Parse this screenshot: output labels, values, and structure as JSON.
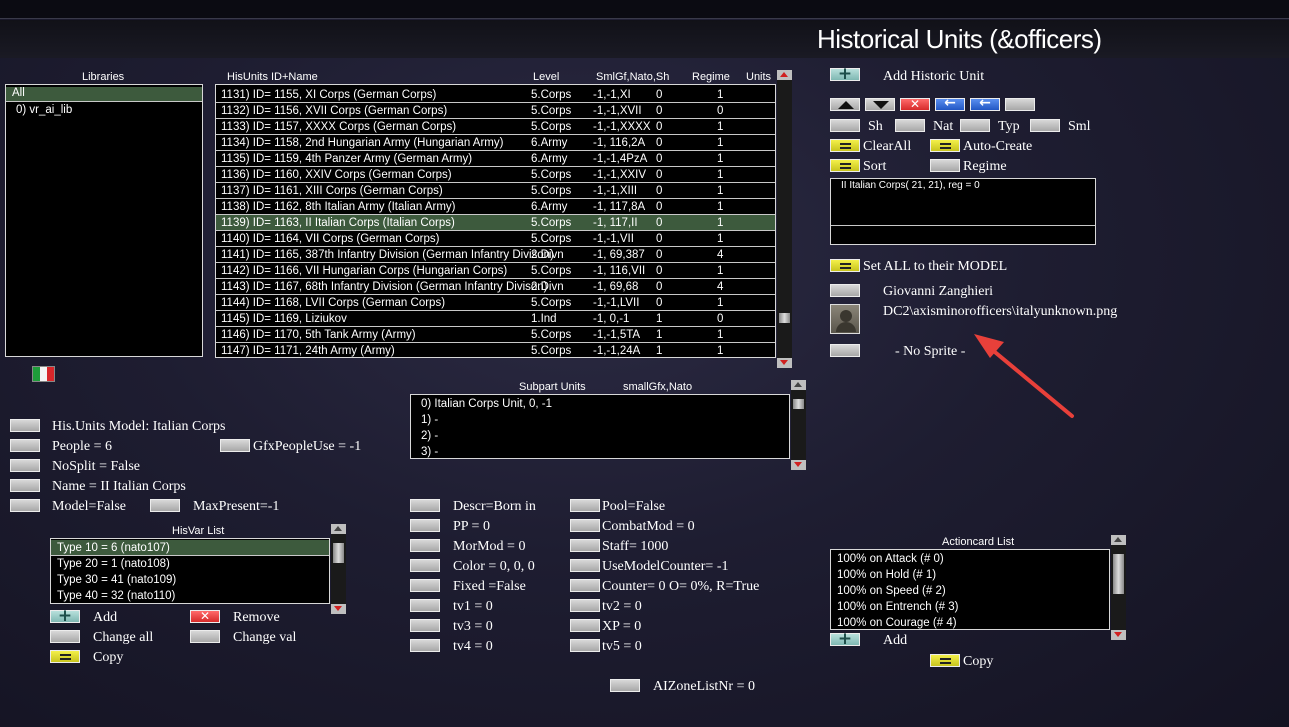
{
  "title": "Historical Units (&officers)",
  "libraries": {
    "header": "Libraries",
    "items": [
      "All",
      "0) vr_ai_lib"
    ]
  },
  "hisunits": {
    "headers": {
      "name": "HisUnits ID+Name",
      "level": "Level",
      "smlgf": "SmlGf,Nato,Sh",
      "regime": "Regime",
      "units": "Units"
    },
    "rows": [
      {
        "name": "1131) ID= 1155, XI Corps (German Corps)",
        "level": "5.Corps",
        "gfx": "-1,-1,XI",
        "sh": "0",
        "reg": "1"
      },
      {
        "name": "1132) ID= 1156, XVII Corps (German Corps)",
        "level": "5.Corps",
        "gfx": "-1,-1,XVII",
        "sh": "0",
        "reg": "0"
      },
      {
        "name": "1133) ID= 1157, XXXX Corps (German Corps)",
        "level": "5.Corps",
        "gfx": "-1,-1,XXXX",
        "sh": "0",
        "reg": "1"
      },
      {
        "name": "1134) ID= 1158, 2nd Hungarian Army (Hungarian Army)",
        "level": "6.Army",
        "gfx": "-1, 116,2A",
        "sh": "0",
        "reg": "1"
      },
      {
        "name": "1135) ID= 1159, 4th Panzer Army (German Army)",
        "level": "6.Army",
        "gfx": "-1,-1,4PzA",
        "sh": "0",
        "reg": "1"
      },
      {
        "name": "1136) ID= 1160, XXIV Corps (German Corps)",
        "level": "5.Corps",
        "gfx": "-1,-1,XXIV",
        "sh": "0",
        "reg": "1"
      },
      {
        "name": "1137) ID= 1161, XIII Corps (German Corps)",
        "level": "5.Corps",
        "gfx": "-1,-1,XIII",
        "sh": "0",
        "reg": "1"
      },
      {
        "name": "1138) ID= 1162, 8th Italian Army (Italian Army)",
        "level": "6.Army",
        "gfx": "-1, 117,8A",
        "sh": "0",
        "reg": "1"
      },
      {
        "name": "1139) ID= 1163, II Italian Corps (Italian Corps)",
        "level": "5.Corps",
        "gfx": "-1, 117,II",
        "sh": "0",
        "reg": "1"
      },
      {
        "name": "1140) ID= 1164, VII Corps (German Corps)",
        "level": "5.Corps",
        "gfx": "-1,-1,VII",
        "sh": "0",
        "reg": "1"
      },
      {
        "name": "1141) ID= 1165, 387th Infantry Division (German Infantry Divison)",
        "level": "2.Divn",
        "gfx": "-1, 69,387",
        "sh": "0",
        "reg": "4"
      },
      {
        "name": "1142) ID= 1166, VII Hungarian Corps (Hungarian Corps)",
        "level": "5.Corps",
        "gfx": "-1, 116,VII",
        "sh": "0",
        "reg": "1"
      },
      {
        "name": "1143) ID= 1167, 68th Infantry Division (German Infantry Divison)",
        "level": "2.Divn",
        "gfx": "-1, 69,68",
        "sh": "0",
        "reg": "4"
      },
      {
        "name": "1144) ID= 1168, LVII Corps (German Corps)",
        "level": "5.Corps",
        "gfx": "-1,-1,LVII",
        "sh": "0",
        "reg": "1"
      },
      {
        "name": "1145) ID= 1169, Liziukov",
        "level": "1.Ind",
        "gfx": "-1, 0,-1",
        "sh": "1",
        "reg": "0"
      },
      {
        "name": "1146) ID= 1170, 5th Tank Army (Army)",
        "level": "5.Corps",
        "gfx": "-1,-1,5TA",
        "sh": "1",
        "reg": "1"
      },
      {
        "name": "1147) ID= 1171, 24th Army (Army)",
        "level": "5.Corps",
        "gfx": "-1,-1,24A",
        "sh": "1",
        "reg": "1"
      }
    ]
  },
  "right_panel": {
    "add_historic_unit": "Add Historic Unit",
    "sh": "Sh",
    "nat": "Nat",
    "typ": "Typ",
    "sml": "Sml",
    "clear_all": "ClearAll",
    "auto_create": "Auto-Create",
    "sort": "Sort",
    "regime": "Regime",
    "info_text": "II Italian Corps( 21, 21), reg =  0",
    "set_all": "Set ALL to their MODEL",
    "officer_name": "Giovanni Zanghieri",
    "officer_path": "DC2\\axisminorofficers\\italyunknown.png",
    "no_sprite": "- No Sprite -"
  },
  "subpart": {
    "header_a": "Subpart Units",
    "header_b": "smallGfx,Nato",
    "items": [
      "0) Italian Corps Unit,  0, -1",
      "1)  -",
      "2)  -",
      "3)  -"
    ]
  },
  "model_props": {
    "model": "His.Units Model: Italian Corps",
    "people": "People = 6",
    "gfx_people": "GfxPeopleUse = -1",
    "nosplit": "NoSplit = False",
    "name": "Name = II Italian Corps",
    "model_false": "Model=False",
    "max_present": "MaxPresent=-1"
  },
  "hisvar": {
    "header": "HisVar List",
    "items": [
      "Type 10 = 6 (nato107)",
      "Type 20 = 1 (nato108)",
      "Type 30 = 41 (nato109)",
      "Type 40 = 32 (nato110)"
    ],
    "add": "Add",
    "remove": "Remove",
    "change_all": "Change all",
    "change_val": "Change val",
    "copy": "Copy"
  },
  "mid_props": {
    "left": [
      "Descr=Born in",
      "PP =  0",
      "MorMod =  0",
      "Color =  0, 0, 0",
      "Fixed =False",
      "tv1 =  0",
      "tv3 =  0",
      "tv4 =  0"
    ],
    "right": [
      "Pool=False",
      "CombatMod =  0",
      "Staff=  1000",
      "UseModelCounter= -1",
      "Counter=  0 O=  0%, R=True",
      "tv2 =  0",
      "XP =  0",
      "tv5 =  0"
    ],
    "aizone": "AIZoneListNr = 0"
  },
  "actioncards": {
    "header": "Actioncard List",
    "items": [
      "100% on Attack (# 0)",
      "100% on Hold (# 1)",
      "100% on Speed (# 2)",
      "100% on Entrench (# 3)",
      "100% on Courage (# 4)"
    ],
    "add": "Add",
    "copy": "Copy"
  },
  "colors": {
    "selected_row": "#3d5a3d",
    "annotation_arrow": "#e8403a"
  }
}
